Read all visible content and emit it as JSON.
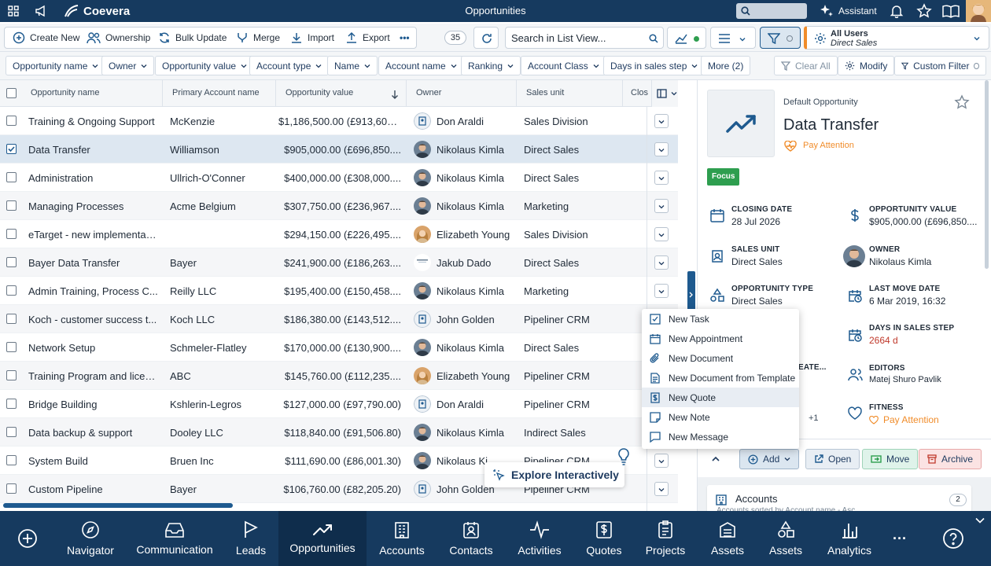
{
  "app": {
    "name": "Coevera",
    "page_title": "Opportunities",
    "assistant_label": "Assistant"
  },
  "toolbar": {
    "create_new": "Create New",
    "ownership": "Ownership",
    "bulk_update": "Bulk Update",
    "merge": "Merge",
    "import": "Import",
    "export": "Export",
    "count": "35",
    "search_placeholder": "Search in List View...",
    "user_filter_title": "All Users",
    "user_filter_sub": "Direct Sales"
  },
  "filters": [
    "Opportunity name",
    "Owner",
    "Opportunity value",
    "Account type",
    "Name",
    "Account name",
    "Ranking",
    "Account Class",
    "Days in sales step",
    "More (2)"
  ],
  "filter_actions": {
    "clear_all": "Clear All",
    "modify": "Modify",
    "custom_filter": "Custom Filter"
  },
  "columns": [
    "Opportunity name",
    "Primary Account name",
    "Opportunity value",
    "Owner",
    "Sales unit",
    "Clos"
  ],
  "rows": [
    {
      "name": "Training & Ongoing Support",
      "account": "McKenzie",
      "value": "$1,186,500.00 (£913,605...",
      "owner": "Don Araldi",
      "unit": "Sales Division",
      "avatar": "placeholder",
      "selected": false
    },
    {
      "name": "Data Transfer",
      "account": "Williamson",
      "value": "$905,000.00 (£696,850....",
      "owner": "Nikolaus Kimla",
      "unit": "Direct Sales",
      "avatar": "man",
      "selected": true
    },
    {
      "name": "Administration",
      "account": "Ullrich-O'Conner",
      "value": "$400,000.00 (£308,000....",
      "owner": "Nikolaus Kimla",
      "unit": "Direct Sales",
      "avatar": "man",
      "selected": false
    },
    {
      "name": "Managing Processes",
      "account": "Acme Belgium",
      "value": "$307,750.00 (£236,967....",
      "owner": "Nikolaus Kimla",
      "unit": "Marketing",
      "avatar": "man",
      "selected": false
    },
    {
      "name": "eTarget - new implementati...",
      "account": "",
      "value": "$294,150.00 (£226,495....",
      "owner": "Elizabeth Young",
      "unit": "Sales Division",
      "avatar": "woman",
      "selected": false
    },
    {
      "name": "Bayer Data Transfer",
      "account": "Bayer",
      "value": "$241,900.00 (£186,263....",
      "owner": "Jakub Dado",
      "unit": "Direct Sales",
      "avatar": "jakub",
      "selected": false
    },
    {
      "name": "Admin Training, Process C...",
      "account": "Reilly LLC",
      "value": "$195,400.00 (£150,458....",
      "owner": "Nikolaus Kimla",
      "unit": "Marketing",
      "avatar": "man",
      "selected": false
    },
    {
      "name": "Koch - customer success t...",
      "account": "Koch LLC",
      "value": "$186,380.00 (£143,512....",
      "owner": "John Golden",
      "unit": "Pipeliner CRM",
      "avatar": "placeholder",
      "selected": false
    },
    {
      "name": "Network Setup",
      "account": "Schmeler-Flatley",
      "value": "$170,000.00 (£130,900....",
      "owner": "Nikolaus Kimla",
      "unit": "Direct Sales",
      "avatar": "man",
      "selected": false
    },
    {
      "name": "Training Program and licen...",
      "account": "ABC",
      "value": "$145,760.00 (£112,235....",
      "owner": "Elizabeth Young",
      "unit": "Pipeliner CRM",
      "avatar": "woman",
      "selected": false
    },
    {
      "name": "Bridge Building",
      "account": "Kshlerin-Legros",
      "value": "$127,000.00 (£97,790.00)",
      "owner": "Don Araldi",
      "unit": "Pipeliner CRM",
      "avatar": "placeholder",
      "selected": false
    },
    {
      "name": "Data backup & support",
      "account": "Dooley LLC",
      "value": "$118,840.00 (£91,506.80)",
      "owner": "Nikolaus Kimla",
      "unit": "Indirect Sales",
      "avatar": "man",
      "selected": false
    },
    {
      "name": "System Build",
      "account": "Bruen Inc",
      "value": "$111,690.00 (£86,001.30)",
      "owner": "Nikolaus Ki",
      "unit": "Pipeliner CRM",
      "avatar": "man",
      "selected": false
    },
    {
      "name": "Custom Pipeline",
      "account": "Bayer",
      "value": "$106,760.00 (£82,205.20)",
      "owner": "John Golden",
      "unit": "Pipeliner CRM",
      "avatar": "placeholder",
      "selected": false
    }
  ],
  "details": {
    "type_label": "Default Opportunity",
    "title": "Data Transfer",
    "status": "Pay Attention",
    "badge": "Focus",
    "closing_date_label": "CLOSING DATE",
    "closing_date": "28 Jul 2026",
    "opp_value_label": "OPPORTUNITY VALUE",
    "opp_value": "$905,000.00 (£696,850....",
    "sales_unit_label": "SALES UNIT",
    "sales_unit": "Direct Sales",
    "owner_label": "OWNER",
    "owner": "Nikolaus Kimla",
    "opp_type_label": "OPPORTUNITY TYPE",
    "opp_type": "Direct Sales",
    "last_move_label": "LAST MOVE DATE",
    "last_move": "6 Mar 2019, 16:32",
    "days_label": "DAYS IN SALES STEP",
    "days": "2664 d",
    "created_label": "EATE...",
    "editors_label": "EDITORS",
    "editors": "Matej Shuro Pavlik",
    "plus_count": "+1",
    "fitness_label": "FITNESS",
    "fitness": "Pay Attention",
    "add": "Add",
    "open": "Open",
    "move": "Move",
    "archive": "Archive",
    "accounts_title": "Accounts",
    "accounts_count": "2",
    "accounts_sub": "Accounts sorted by Account name - Asc"
  },
  "add_menu": [
    "New Task",
    "New Appointment",
    "New Document",
    "New Document from Template",
    "New Quote",
    "New Note",
    "New Message"
  ],
  "explore": "Explore Interactively",
  "nav": [
    "Navigator",
    "Communication",
    "Leads",
    "Opportunities",
    "Accounts",
    "Contacts",
    "Activities",
    "Quotes",
    "Projects",
    "Assets",
    "Assets",
    "Analytics"
  ],
  "colors": {
    "primary": "#163a5f",
    "accent": "#f08c2a",
    "selected_row": "#dde7f1",
    "danger": "#c0392b",
    "focus_badge": "#2e9e4f"
  }
}
